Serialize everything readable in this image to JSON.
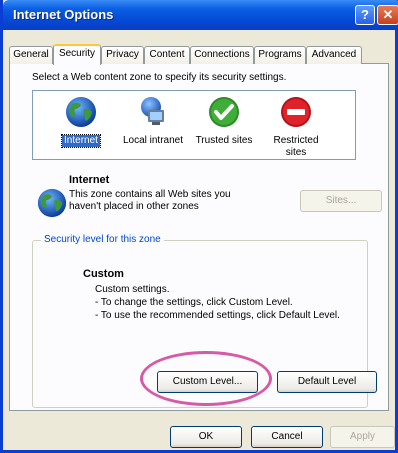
{
  "window": {
    "title": "Internet Options"
  },
  "titlebar_buttons": {
    "help": "?",
    "close": "✕"
  },
  "tabs": [
    {
      "label": "General"
    },
    {
      "label": "Security"
    },
    {
      "label": "Privacy"
    },
    {
      "label": "Content"
    },
    {
      "label": "Connections"
    },
    {
      "label": "Programs"
    },
    {
      "label": "Advanced"
    }
  ],
  "security": {
    "instruction": "Select a Web content zone to specify its security settings.",
    "zones": [
      {
        "label": "Internet",
        "icon": "globe-icon"
      },
      {
        "label": "Local intranet",
        "icon": "computer-network-icon"
      },
      {
        "label": "Trusted sites",
        "icon": "checkmark-icon"
      },
      {
        "label": "Restricted sites",
        "icon": "no-entry-icon"
      }
    ],
    "zone_info": {
      "title": "Internet",
      "description_line1": "This zone contains all Web sites you",
      "description_line2": "haven't placed in other zones",
      "sites_button": "Sites..."
    },
    "level_group_title": "Security level for this zone",
    "level": {
      "name": "Custom",
      "line1": "Custom settings.",
      "line2": "- To change the settings, click Custom Level.",
      "line3": "- To use the recommended settings, click Default Level."
    },
    "custom_level_button": "Custom Level...",
    "default_level_button": "Default Level"
  },
  "footer": {
    "ok": "OK",
    "cancel": "Cancel",
    "apply": "Apply"
  },
  "colors": {
    "title_bar": "#0a5fe3",
    "annotation_ring": "#d65aa6",
    "selection": "#316ac5"
  }
}
